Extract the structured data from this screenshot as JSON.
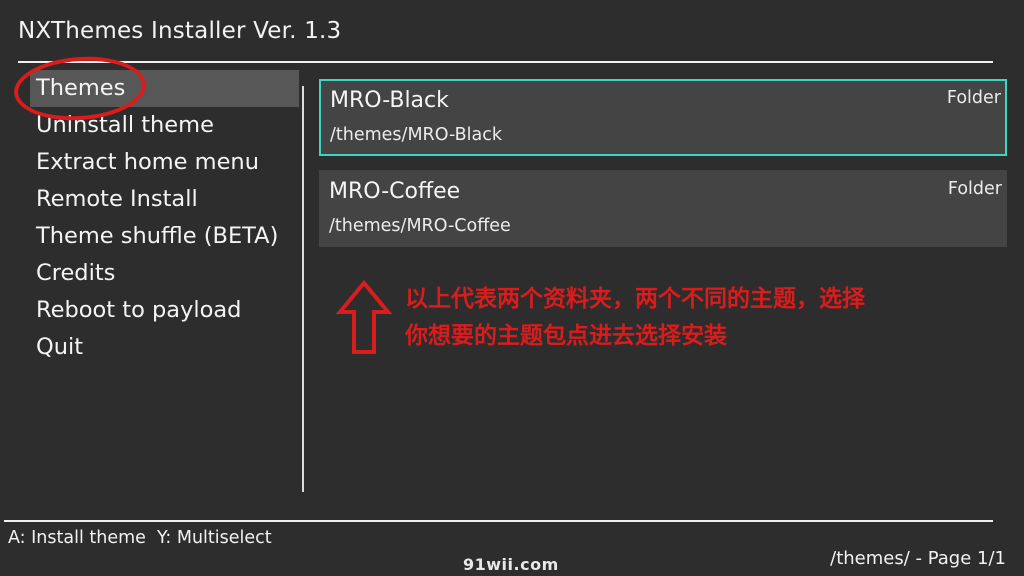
{
  "header": {
    "title": "NXThemes Installer Ver. 1.3"
  },
  "sidebar": {
    "items": [
      {
        "label": "Themes",
        "active": true
      },
      {
        "label": "Uninstall theme",
        "active": false
      },
      {
        "label": "Extract home menu",
        "active": false
      },
      {
        "label": "Remote Install",
        "active": false
      },
      {
        "label": "Theme shuffle (BETA)",
        "active": false
      },
      {
        "label": "Credits",
        "active": false
      },
      {
        "label": "Reboot to payload",
        "active": false
      },
      {
        "label": "Quit",
        "active": false
      }
    ]
  },
  "file_list": {
    "items": [
      {
        "name": "MRO-Black",
        "path": "/themes/MRO-Black",
        "type": "Folder",
        "selected": true
      },
      {
        "name": "MRO-Coffee",
        "path": "/themes/MRO-Coffee",
        "type": "Folder",
        "selected": false
      }
    ]
  },
  "annotation": {
    "line1": "以上代表两个资料夹，两个不同的主题，选择",
    "line2": "你想要的主题包点进去选择安装",
    "color": "#d91c1c"
  },
  "footer": {
    "hints": "A: Install theme  Y: Multiselect",
    "status": "/themes/ - Page 1/1",
    "watermark": "91wii.com"
  },
  "colors": {
    "background": "#2d2d2d",
    "active_item": "#575757",
    "card": "#444444",
    "selection_border": "#3ed6c0"
  }
}
